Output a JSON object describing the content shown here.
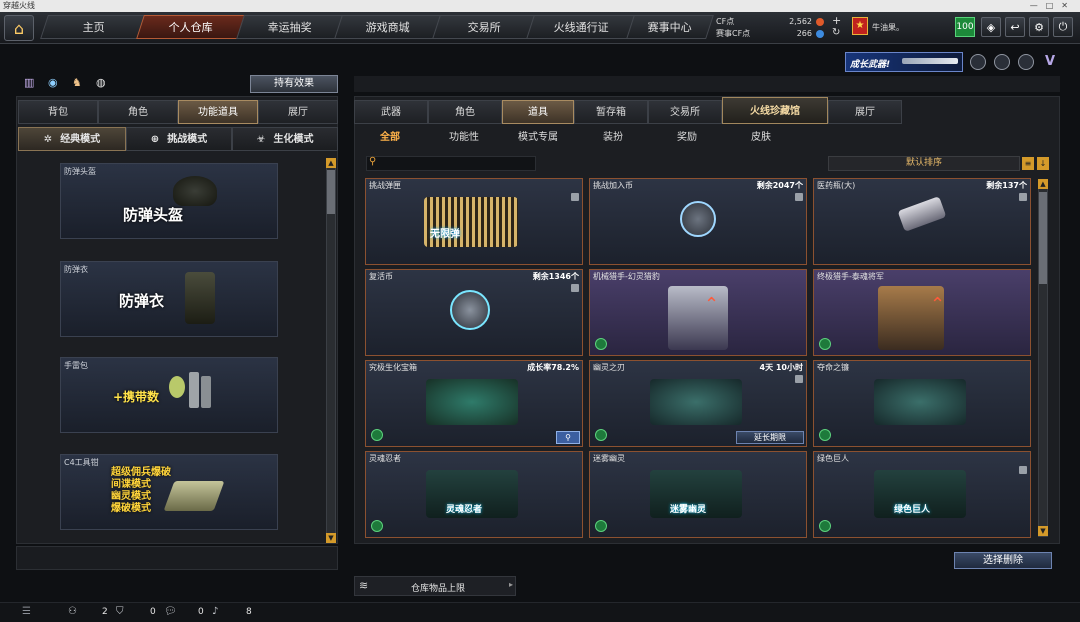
{
  "window": {
    "title": "穿越火线"
  },
  "nav": {
    "tabs": [
      "主页",
      "个人仓库",
      "幸运抽奖",
      "游戏商城",
      "交易所",
      "火线通行证",
      "赛事中心"
    ]
  },
  "currency": {
    "cf_label": "CF点",
    "cf_value": "2,562",
    "event_label": "赛事CF点",
    "event_value": "266"
  },
  "user": {
    "name": "牛油果。",
    "level": "100"
  },
  "banner": {
    "text": "成长武器!"
  },
  "left": {
    "effect_button": "持有效果",
    "tabs": [
      "背包",
      "角色",
      "功能道具",
      "展厅"
    ],
    "modes": [
      "经典模式",
      "挑战模式",
      "生化模式"
    ],
    "items": [
      {
        "title": "防弹头盔",
        "label": "防弹头盔"
      },
      {
        "title": "防弹衣",
        "label": "防弹衣"
      },
      {
        "title": "手雷包",
        "label": "+携带数"
      },
      {
        "title": "C4工具钳",
        "lines": [
          "超级佣兵爆破",
          "间谍模式",
          "幽灵模式",
          "爆破模式"
        ]
      }
    ]
  },
  "right": {
    "tabs": [
      "武器",
      "角色",
      "道具",
      "暂存箱",
      "交易所",
      "火线珍藏馆",
      "展厅"
    ],
    "filters": [
      "全部",
      "功能性",
      "模式专属",
      "装扮",
      "奖励",
      "皮肤"
    ],
    "sort": "默认排序",
    "items": [
      {
        "name": "挑战弹匣",
        "right": "",
        "art_text": "无限弹"
      },
      {
        "name": "挑战加入币",
        "right": "剩余2047个"
      },
      {
        "name": "医药瓶(大)",
        "right": "剩余137个"
      },
      {
        "name": "复活币",
        "right": "剩余1346个"
      },
      {
        "name": "机械猎手-幻灵猎豹",
        "right": ""
      },
      {
        "name": "终极猎手-泰魂将军",
        "right": ""
      },
      {
        "name": "究极生化宝箱",
        "right": "成长率78.2%"
      },
      {
        "name": "幽灵之刃",
        "right": "4天 10小时",
        "button": "延长期限"
      },
      {
        "name": "夺命之镰",
        "right": ""
      },
      {
        "name": "灵魂忍者",
        "right": "",
        "art_text": "灵魂忍者"
      },
      {
        "name": "迷雾幽灵",
        "right": "",
        "art_text": "迷雾幽灵"
      },
      {
        "name": "绿色巨人",
        "right": "",
        "art_text": "绿色巨人"
      }
    ],
    "delete_button": "选择删除",
    "capacity_label": "仓库物品上限"
  },
  "statusbar": {
    "values": [
      "2",
      "0",
      "0",
      "8"
    ]
  }
}
